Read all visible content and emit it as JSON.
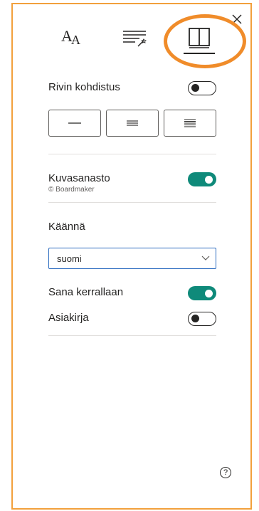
{
  "panel": {
    "close_glyph": "✕"
  },
  "tabs": [
    {
      "name": "text-preferences",
      "icon": "text-size-icon",
      "big_glyph": "A",
      "small_glyph": "A"
    },
    {
      "name": "grammar-options",
      "icon": "grammar-wand-icon"
    },
    {
      "name": "reading-preferences",
      "icon": "book-icon",
      "active": true
    }
  ],
  "line_focus": {
    "label": "Rivin kohdistus",
    "enabled": false,
    "options": [
      "one-line",
      "three-lines",
      "five-lines"
    ]
  },
  "picture_dictionary": {
    "label": "Kuvasanasto",
    "credit": "© Boardmaker",
    "enabled": true
  },
  "translate": {
    "heading": "Käännä",
    "language": "suomi",
    "word_by_word": {
      "label": "Sana kerrallaan",
      "enabled": true
    },
    "document": {
      "label": "Asiakirja",
      "enabled": false
    }
  },
  "help": {
    "glyph": "?"
  },
  "colors": {
    "accent_toggle": "#0f8a7a",
    "frame": "#f2a03c",
    "highlight_ring": "#f08c2a",
    "dropdown_border": "#2b6bbf"
  }
}
